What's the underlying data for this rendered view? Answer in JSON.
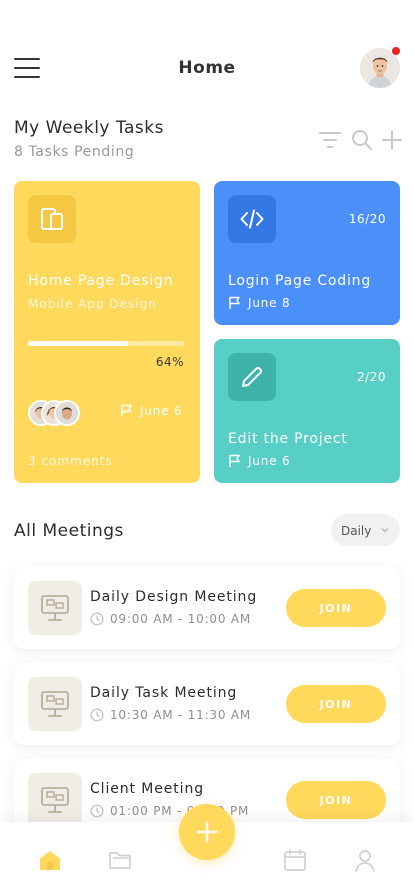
{
  "header": {
    "title": "Home"
  },
  "tasks_section": {
    "title": "My Weekly Tasks",
    "subtitle": "8 Tasks Pending"
  },
  "cards": [
    {
      "title": "Home Page Design",
      "subtitle": "Mobile App Design",
      "progress": 0.64,
      "progress_label": "64%",
      "due": "June 6",
      "comments": "3 comments",
      "icon": "tablet-icon"
    },
    {
      "title": "Login Page Coding",
      "count": "16/20",
      "due": "June 8",
      "icon": "code-icon"
    },
    {
      "title": "Edit the Project",
      "count": "2/20",
      "due": "June 6",
      "icon": "pencil-icon"
    }
  ],
  "meetings_section": {
    "title": "All Meetings",
    "filter": "Daily"
  },
  "meetings": [
    {
      "title": "Daily Design Meeting",
      "time": "09:00 AM - 10:00 AM",
      "join": "JOIN"
    },
    {
      "title": "Daily Task Meeting",
      "time": "10:30 AM - 11:30 AM",
      "join": "JOIN"
    },
    {
      "title": "Client Meeting",
      "time": "01:00 PM - 02:00 PM",
      "join": "JOIN"
    }
  ],
  "colors": {
    "accent_yellow": "#ffd95c",
    "accent_blue": "#4b8ff8",
    "accent_teal": "#57cfc7",
    "notification": "#e8241f"
  },
  "nav": {
    "items": [
      "home-icon",
      "folder-icon",
      "add-icon",
      "calendar-icon",
      "profile-icon"
    ],
    "active": "home-icon"
  }
}
